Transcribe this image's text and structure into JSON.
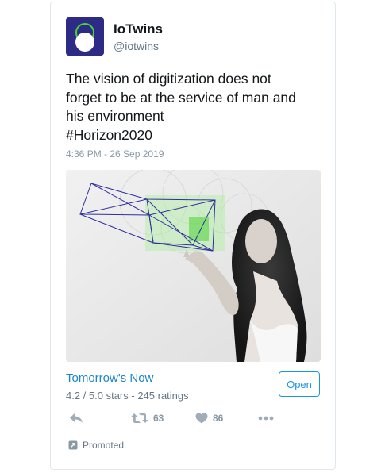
{
  "account": {
    "name": "IoTwins",
    "handle": "@iotwins"
  },
  "tweet": {
    "lines": [
      "The vision of digitization does not",
      "forget to be at the service of man and",
      "his environment",
      "#Horizon2020"
    ],
    "timestamp": "4:36 PM - 26 Sep 2019"
  },
  "app_card": {
    "name": "Tomorrow's Now",
    "rating": "4.2 / 5.0 stars - 245 ratings",
    "open_label": "Open"
  },
  "actions": {
    "reply_icon": "reply-arrow",
    "retweet_icon": "retweet-arrows",
    "retweet_count": "63",
    "like_icon": "heart",
    "like_count": "86",
    "more_icon": "ellipsis"
  },
  "promoted": {
    "icon": "promoted-arrow",
    "label": "Promoted"
  },
  "colors": {
    "brand": "#2d2b86",
    "link": "#1b85c9",
    "button": "#1b95e0",
    "muted": "#8899a6",
    "accent_green": "#4cd137"
  }
}
